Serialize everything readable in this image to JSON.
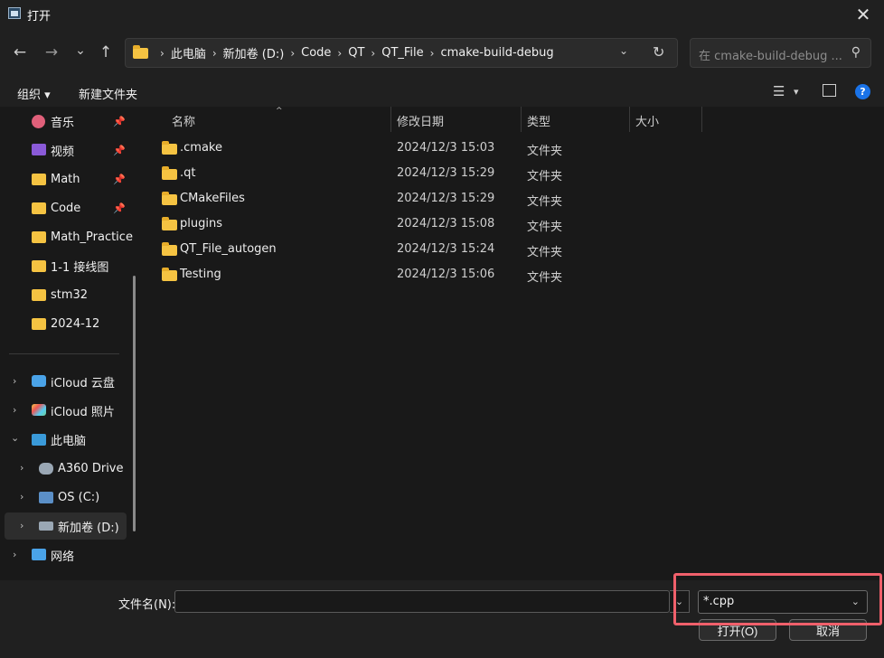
{
  "window": {
    "title": "打开",
    "close_glyph": "✕"
  },
  "nav": {
    "back_glyph": "←",
    "forward_glyph": "→",
    "recent_glyph": "⌄",
    "up_glyph": "↑",
    "breadcrumb": [
      "此电脑",
      "新加卷 (D:)",
      "Code",
      "QT",
      "QT_File",
      "cmake-build-debug"
    ],
    "search_placeholder": "在 cmake-build-debug ..."
  },
  "toolbar": {
    "organize": "组织 ▾",
    "new_folder": "新建文件夹",
    "help": "?"
  },
  "sidebar": {
    "items": [
      {
        "label": "音乐",
        "icon": "music-icon",
        "pinned": true
      },
      {
        "label": "视频",
        "icon": "video-icon",
        "pinned": true
      },
      {
        "label": "Math",
        "icon": "folder-icon",
        "pinned": true
      },
      {
        "label": "Code",
        "icon": "folder-icon",
        "pinned": true
      },
      {
        "label": "Math_Practice",
        "icon": "folder-icon",
        "pinned": false
      },
      {
        "label": "1-1 接线图",
        "icon": "folder-icon",
        "pinned": false
      },
      {
        "label": "stm32",
        "icon": "folder-icon",
        "pinned": false
      },
      {
        "label": "2024-12",
        "icon": "folder-icon",
        "pinned": false
      },
      {
        "label": "iCloud 云盘",
        "icon": "icloud-drive-icon",
        "pinned": false
      },
      {
        "label": "iCloud 照片",
        "icon": "icloud-photos-icon",
        "pinned": false
      },
      {
        "label": "此电脑",
        "icon": "computer-icon",
        "pinned": false
      },
      {
        "label": "A360 Drive",
        "icon": "a360-drive-icon",
        "pinned": false
      },
      {
        "label": "OS (C:)",
        "icon": "os-drive-icon",
        "pinned": false
      },
      {
        "label": "新加卷 (D:)",
        "icon": "disk-drive-icon",
        "pinned": false
      },
      {
        "label": "网络",
        "icon": "network-icon",
        "pinned": false
      }
    ]
  },
  "columns": [
    "名称",
    "修改日期",
    "类型",
    "大小"
  ],
  "files": [
    {
      "name": ".cmake",
      "date": "2024/12/3 15:03",
      "type": "文件夹"
    },
    {
      "name": ".qt",
      "date": "2024/12/3 15:29",
      "type": "文件夹"
    },
    {
      "name": "CMakeFiles",
      "date": "2024/12/3 15:29",
      "type": "文件夹"
    },
    {
      "name": "plugins",
      "date": "2024/12/3 15:08",
      "type": "文件夹"
    },
    {
      "name": "QT_File_autogen",
      "date": "2024/12/3 15:24",
      "type": "文件夹"
    },
    {
      "name": "Testing",
      "date": "2024/12/3 15:06",
      "type": "文件夹"
    }
  ],
  "footer": {
    "filename_label": "文件名(N):",
    "filename_value": "",
    "filetype_value": "*.cpp",
    "open_button": "打开(O)",
    "cancel_button": "取消"
  },
  "colors": {
    "accent": "#1a73e8",
    "highlight": "#f0606b",
    "folder": "#f5c342"
  }
}
